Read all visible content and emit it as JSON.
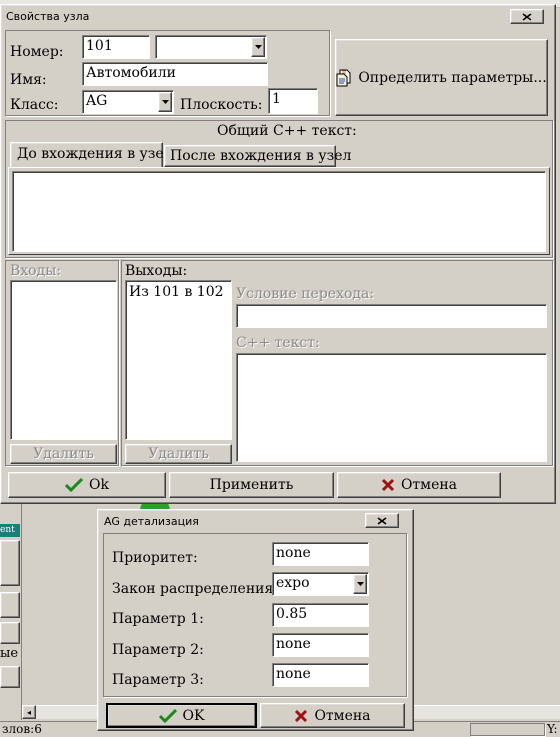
{
  "background": {
    "status_left": "злов:6",
    "status_right": "Y:",
    "side_label_1": "ent",
    "side_label_2": "ые"
  },
  "node_dialog": {
    "title": "Свойства узла",
    "number_label": "Номер:",
    "number_value": "101",
    "number_dropdown_value": "",
    "name_label": "Имя:",
    "name_value": "Автомобили",
    "class_label": "Класс:",
    "class_value": "AG",
    "plane_label": "Плоскость:",
    "plane_value": "1",
    "define_button": "Определить параметры...",
    "common_cpp_label": "Общий С++ текст:",
    "tabs": [
      "До вхождения в узел",
      "После вхождения в узел"
    ],
    "inputs_label": "Входы:",
    "outputs_label": "Выходы:",
    "outputs_items": [
      "Из 101 в 102"
    ],
    "delete_label": "Удалить",
    "transition_label": "Условие перехода:",
    "cpp_text_label": "С++ текст:",
    "ok_button": "Ok",
    "apply_button": "Применить",
    "cancel_button": "Отмена"
  },
  "ag_dialog": {
    "title": "AG детализация",
    "priority_label": "Приоритет:",
    "priority_value": "none",
    "distribution_label": "Закон распределения:",
    "distribution_value": "expo",
    "param1_label": "Параметр 1:",
    "param1_value": "0.85",
    "param2_label": "Параметр 2:",
    "param2_value": "none",
    "param3_label": "Параметр 3:",
    "param3_value": "none",
    "ok_button": "OK",
    "cancel_button": "Отмена"
  },
  "colors": {
    "face": "#d4d0c8",
    "ok_check": "#1a8a1a",
    "cancel_x": "#a01010",
    "accent_teal": "#1a7f7a"
  }
}
